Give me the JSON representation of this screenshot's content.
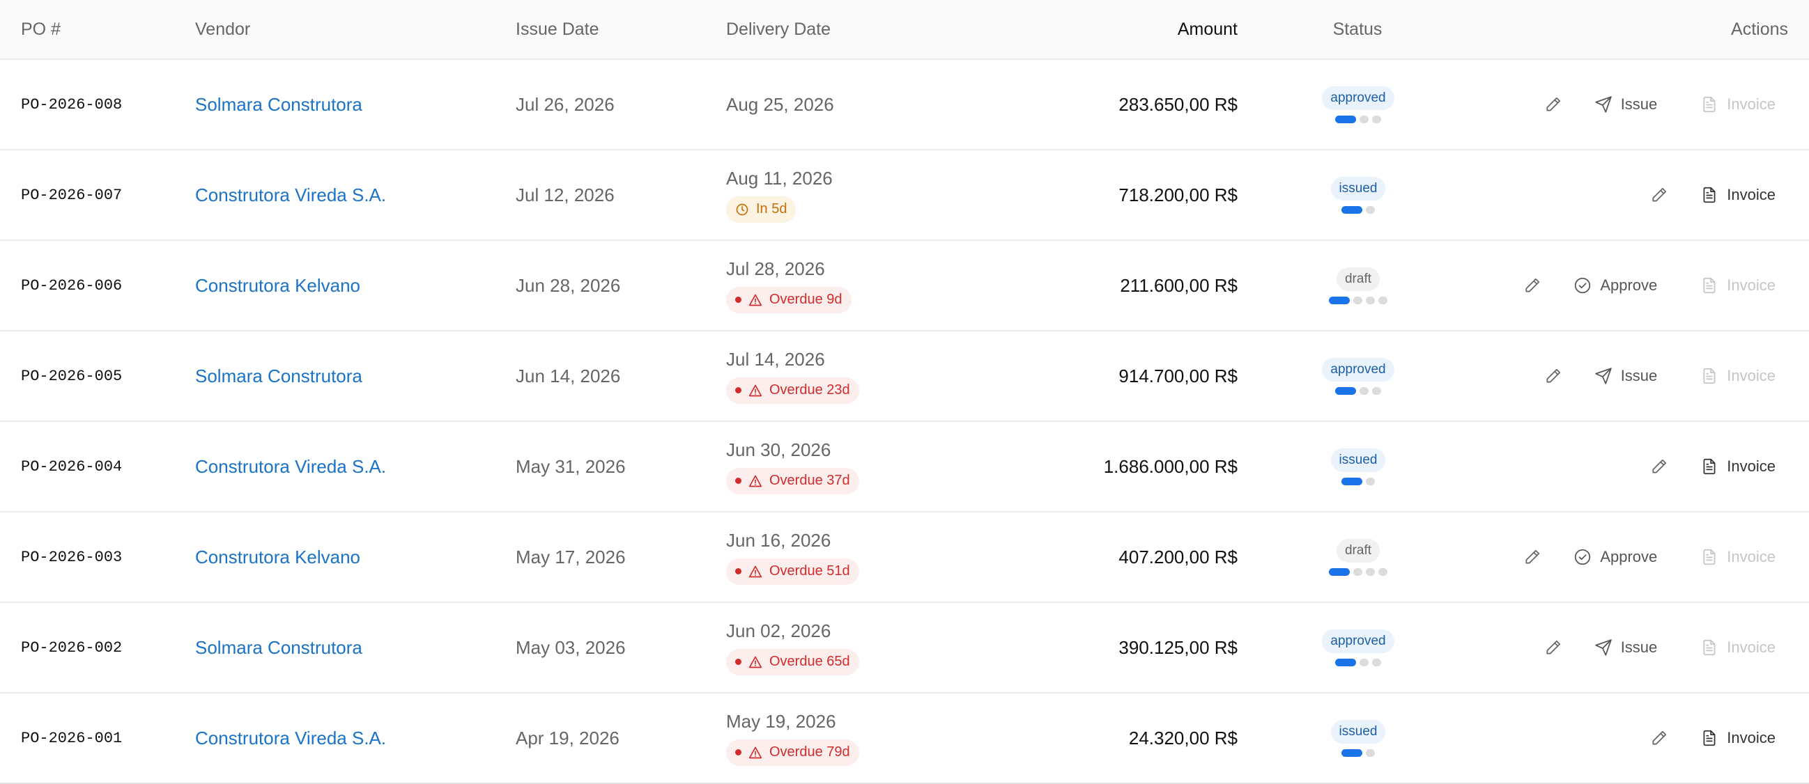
{
  "columns": {
    "po": "PO #",
    "vendor": "Vendor",
    "issue_date": "Issue Date",
    "delivery_date": "Delivery Date",
    "amount": "Amount",
    "status": "Status",
    "actions": "Actions"
  },
  "colors": {
    "link": "#1a73c9",
    "progress_active": "#1a73e8",
    "overdue": "#d02c2c",
    "soon": "#c3700a"
  },
  "rows": [
    {
      "po": "PO-2026-008",
      "vendor": "Solmara Construtora",
      "issue_date": "Jul 26, 2026",
      "delivery_date": "Aug 25, 2026",
      "due": null,
      "amount": "283.650,00 R$",
      "status": "approved",
      "actions": {
        "primary": "Issue",
        "invoice": "Invoice",
        "invoice_enabled": false
      }
    },
    {
      "po": "PO-2026-007",
      "vendor": "Construtora Vireda S.A.",
      "issue_date": "Jul 12, 2026",
      "delivery_date": "Aug 11, 2026",
      "due": {
        "kind": "soon",
        "text": "In 5d"
      },
      "amount": "718.200,00 R$",
      "status": "issued",
      "actions": {
        "primary": null,
        "invoice": "Invoice",
        "invoice_enabled": true
      }
    },
    {
      "po": "PO-2026-006",
      "vendor": "Construtora Kelvano",
      "issue_date": "Jun 28, 2026",
      "delivery_date": "Jul 28, 2026",
      "due": {
        "kind": "overdue",
        "text": "Overdue 9d"
      },
      "amount": "211.600,00 R$",
      "status": "draft",
      "actions": {
        "primary": "Approve",
        "invoice": "Invoice",
        "invoice_enabled": false
      }
    },
    {
      "po": "PO-2026-005",
      "vendor": "Solmara Construtora",
      "issue_date": "Jun 14, 2026",
      "delivery_date": "Jul 14, 2026",
      "due": {
        "kind": "overdue",
        "text": "Overdue 23d"
      },
      "amount": "914.700,00 R$",
      "status": "approved",
      "actions": {
        "primary": "Issue",
        "invoice": "Invoice",
        "invoice_enabled": false
      }
    },
    {
      "po": "PO-2026-004",
      "vendor": "Construtora Vireda S.A.",
      "issue_date": "May 31, 2026",
      "delivery_date": "Jun 30, 2026",
      "due": {
        "kind": "overdue",
        "text": "Overdue 37d"
      },
      "amount": "1.686.000,00 R$",
      "status": "issued",
      "actions": {
        "primary": null,
        "invoice": "Invoice",
        "invoice_enabled": true
      }
    },
    {
      "po": "PO-2026-003",
      "vendor": "Construtora Kelvano",
      "issue_date": "May 17, 2026",
      "delivery_date": "Jun 16, 2026",
      "due": {
        "kind": "overdue",
        "text": "Overdue 51d"
      },
      "amount": "407.200,00 R$",
      "status": "draft",
      "actions": {
        "primary": "Approve",
        "invoice": "Invoice",
        "invoice_enabled": false
      }
    },
    {
      "po": "PO-2026-002",
      "vendor": "Solmara Construtora",
      "issue_date": "May 03, 2026",
      "delivery_date": "Jun 02, 2026",
      "due": {
        "kind": "overdue",
        "text": "Overdue 65d"
      },
      "amount": "390.125,00 R$",
      "status": "approved",
      "actions": {
        "primary": "Issue",
        "invoice": "Invoice",
        "invoice_enabled": false
      }
    },
    {
      "po": "PO-2026-001",
      "vendor": "Construtora Vireda S.A.",
      "issue_date": "Apr 19, 2026",
      "delivery_date": "May 19, 2026",
      "due": {
        "kind": "overdue",
        "text": "Overdue 79d"
      },
      "amount": "24.320,00 R$",
      "status": "issued",
      "actions": {
        "primary": null,
        "invoice": "Invoice",
        "invoice_enabled": true
      }
    }
  ]
}
